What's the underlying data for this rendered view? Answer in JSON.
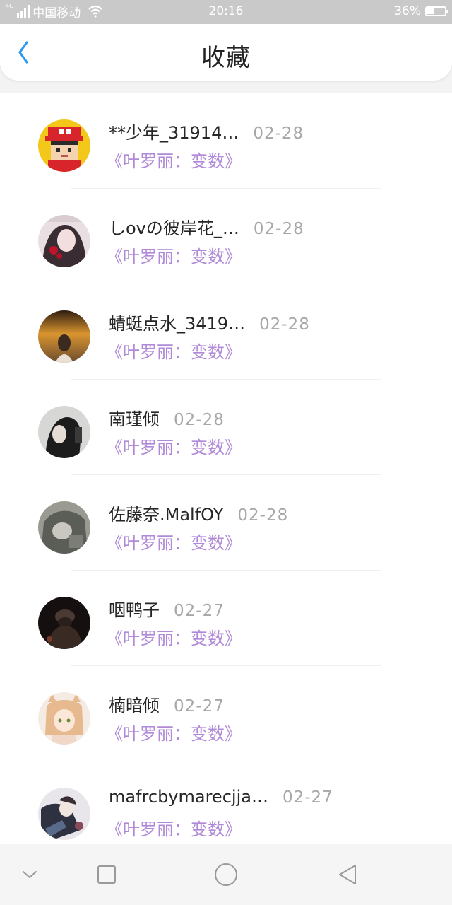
{
  "status_bar": {
    "network_tag": "4G",
    "carrier": "中国移动",
    "time": "20:16",
    "battery_percent": "36%",
    "battery_level": 0.36
  },
  "header": {
    "back_icon": "chevron-left-icon",
    "title": "收藏"
  },
  "colors": {
    "accent_blue": "#2a9bf0",
    "book_purple": "#b08ad8",
    "date_gray": "#a7a7a7"
  },
  "items": [
    {
      "username": "**少年_31914…",
      "date": "02-28",
      "book": "《叶罗丽：变数》"
    },
    {
      "username": "しovの彼岸花_…",
      "date": "02-28",
      "book": "《叶罗丽：变数》"
    },
    {
      "username": "蜻蜓点水_3419…",
      "date": "02-28",
      "book": "《叶罗丽：变数》"
    },
    {
      "username": "南瑾倾",
      "date": "02-28",
      "book": "《叶罗丽：变数》"
    },
    {
      "username": "佐藤奈.MalfOY",
      "date": "02-28",
      "book": "《叶罗丽：变数》"
    },
    {
      "username": "咽鸭子",
      "date": "02-27",
      "book": "《叶罗丽：变数》"
    },
    {
      "username": "楠暗倾",
      "date": "02-27",
      "book": "《叶罗丽：变数》"
    },
    {
      "username": "mafrcbymarecjja…",
      "date": "02-27",
      "book": "《叶罗丽：变数》"
    }
  ],
  "nav_bar": {
    "icons": [
      "chevron-down-icon",
      "square-icon",
      "circle-icon",
      "triangle-back-icon"
    ]
  }
}
